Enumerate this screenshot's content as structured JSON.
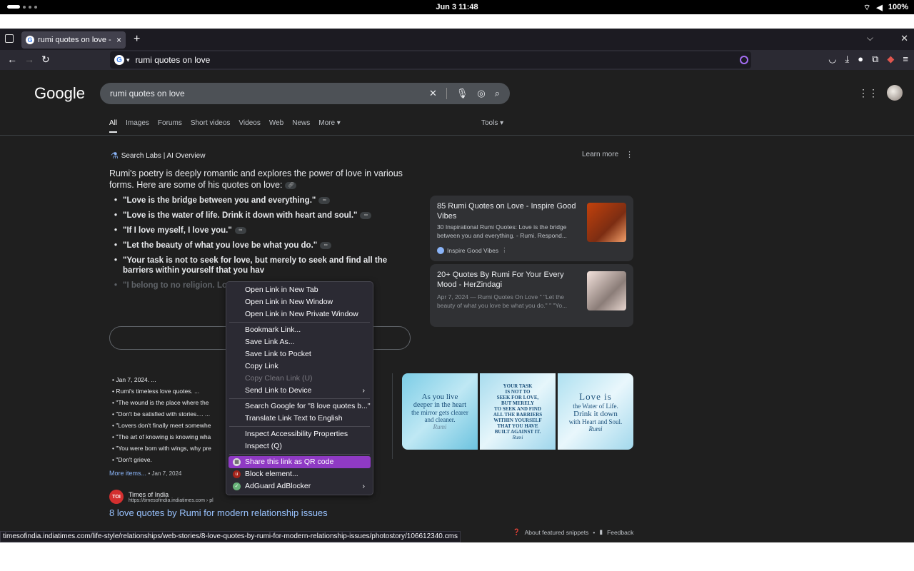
{
  "system": {
    "clock": "Jun 3  11:48",
    "battery": "100%"
  },
  "browser": {
    "tab_title": "rumi quotes on love - G",
    "url_text": "rumi quotes on love",
    "status_url": "timesofindia.indiatimes.com/life-style/relationships/web-stories/8-love-quotes-by-rumi-for-modern-relationship-issues/photostory/106612340.cms"
  },
  "google": {
    "logo": "Google",
    "query": "rumi quotes on love",
    "tabs": [
      "All",
      "Images",
      "Forums",
      "Short videos",
      "Videos",
      "Web",
      "News",
      "More ▾"
    ],
    "tools": "Tools ▾",
    "labs_label": "Search Labs | AI Overview",
    "learn_more": "Learn more",
    "overview_text": "Rumi's poetry is deeply romantic and explores the power of love in various forms. Here are some of his quotes on love:",
    "quotes": [
      "\"Love is the bridge between you and everything.\"",
      "\"Love is the water of life. Drink it down with heart and soul.\"",
      "\"If I love myself, I love you.\"",
      "\"Let the beauty of what you love be what you do.\"",
      "\"Your task is not to seek for love, but merely to seek and find all the barriers within yourself that you hav"
    ],
    "faded_quote": "\"I belong to no religion. Lov",
    "cards": [
      {
        "title": "85 Rumi Quotes on Love - Inspire Good Vibes",
        "snippet": "30 Inspirational Rumi Quotes: Love is the bridge between you and everything. - Rumi. Respond...",
        "source": "Inspire Good Vibes"
      },
      {
        "title": "20+ Quotes By Rumi For Your Every Mood - HerZindagi",
        "snippet": "Apr 7, 2024 — Rumi Quotes On Love \" \"Let the beauty of what you love be what you do.\" \" \"Yo..."
      }
    ],
    "snippet_list": [
      "• Jan 7, 2024. ...",
      "• Rumi's timeless love quotes. ...",
      "• \"The wound is the place where the",
      "• \"Don't be satisfied with stories.... ...",
      "• \"Lovers don't finally meet somewhe",
      "• \"The art of knowing is knowing wha",
      "• \"You were born with wings, why pre",
      "• \"Don't grieve."
    ],
    "more_items": "More items...",
    "more_items_date": "• Jan 7, 2024",
    "result_site": "Times of India",
    "result_url": "https://timesofindia.indiatimes.com › pl",
    "result_title": "8 love quotes by Rumi for modern relationship issues",
    "footer_snippets": "About featured snippets",
    "footer_dot": "•",
    "footer_feedback": "Feedback",
    "image1": {
      "line1": "As you live",
      "line2": "deeper in the heart",
      "line3": "the mirror gets clearer",
      "line4": "and cleaner.",
      "sig": "Rumi"
    },
    "image2": {
      "line1": "YOUR TASK",
      "line2": "IS NOT TO",
      "line3": "SEEK FOR LOVE,",
      "line4": "BUT MERELY",
      "line5": "TO SEEK AND FIND",
      "line6": "ALL THE BARRIERS",
      "line7": "WITHIN YOURSELF",
      "line8": "THAT YOU HAVE",
      "line9": "BUILT AGAINST IT.",
      "sig": "Rumi"
    },
    "image3": {
      "line1": "Love is",
      "line2": "the Water of Life.",
      "line3": "Drink it down",
      "line4": "with Heart and Soul.",
      "sig": "Rumi"
    }
  },
  "context_menu": {
    "items": [
      "Open Link in New Tab",
      "Open Link in New Window",
      "Open Link in New Private Window",
      "Bookmark Link...",
      "Save Link As...",
      "Save Link to Pocket",
      "Copy Link",
      "Copy Clean Link (U)",
      "Send Link to Device",
      "Search Google for \"8 love quotes b...\"",
      "Translate Link Text to English",
      "Inspect Accessibility Properties",
      "Inspect (Q)",
      "Share this link as QR code",
      "Block element...",
      "AdGuard AdBlocker"
    ]
  },
  "colors": {
    "menu_highlight": "#8f3ac4",
    "link_blue": "#99c3ff",
    "page_bg": "#1f1f1f"
  }
}
